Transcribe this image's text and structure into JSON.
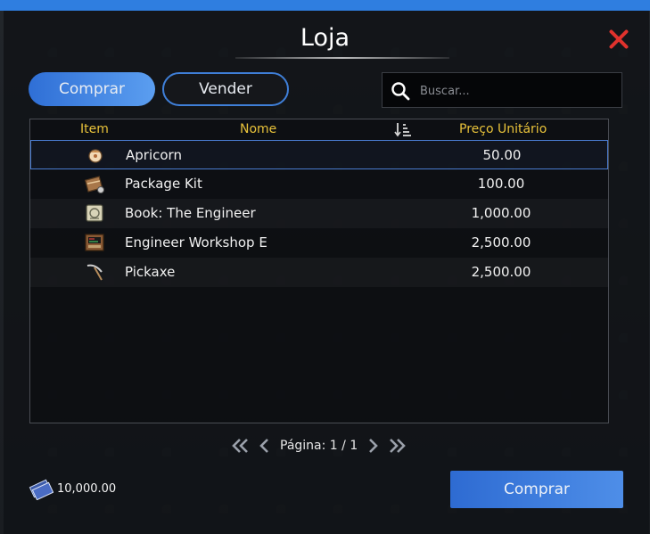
{
  "window": {
    "title": "Loja"
  },
  "tabs": {
    "buy_label": "Comprar",
    "sell_label": "Vender"
  },
  "search": {
    "placeholder": "Buscar..."
  },
  "table": {
    "columns": {
      "item": "Item",
      "name": "Nome",
      "price": "Preço Unitário"
    },
    "rows": [
      {
        "name": "Apricorn",
        "price": "50.00",
        "icon": "apricorn-icon"
      },
      {
        "name": "Package Kit",
        "price": "100.00",
        "icon": "package-kit-icon"
      },
      {
        "name": "Book: The Engineer",
        "price": "1,000.00",
        "icon": "book-icon"
      },
      {
        "name": "Engineer Workshop E",
        "price": "2,500.00",
        "icon": "workshop-icon"
      },
      {
        "name": "Pickaxe",
        "price": "2,500.00",
        "icon": "pickaxe-icon"
      }
    ]
  },
  "pagination": {
    "label": "Página: 1 / 1"
  },
  "wallet": {
    "amount": "10,000.00",
    "icon": "money-icon"
  },
  "footer": {
    "buy_button": "Comprar"
  },
  "colors": {
    "accent": "#2f7ee0",
    "header_text": "#e8c23a",
    "close": "#e0322d"
  }
}
